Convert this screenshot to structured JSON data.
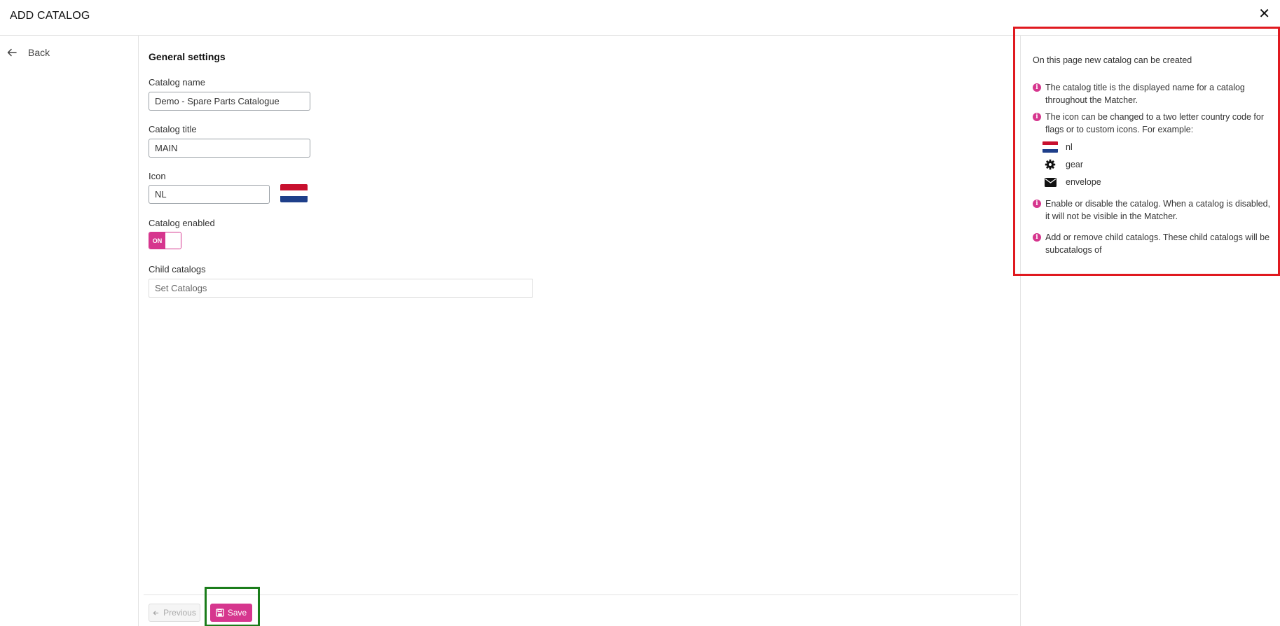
{
  "header": {
    "title": "ADD CATALOG",
    "close_label": "✕"
  },
  "nav": {
    "back_label": "Back"
  },
  "form": {
    "section_title": "General settings",
    "catalog_name": {
      "label": "Catalog name",
      "value": "Demo - Spare Parts Catalogue"
    },
    "catalog_title": {
      "label": "Catalog title",
      "value": "MAIN"
    },
    "icon": {
      "label": "Icon",
      "value": "NL",
      "preview": "flag-nl-icon"
    },
    "catalog_enabled": {
      "label": "Catalog enabled",
      "toggle_text": "ON",
      "state": true
    },
    "child_catalogs": {
      "label": "Child catalogs",
      "placeholder": "Set Catalogs"
    }
  },
  "footer": {
    "previous_label": "Previous",
    "save_label": "Save"
  },
  "help": {
    "intro": "On this page new catalog can be created",
    "items": [
      "The catalog title is the displayed name for a catalog throughout the Matcher.",
      "The icon can be changed to a two letter country code for flags or to custom icons. For example:",
      "Enable or disable the catalog. When a catalog is disabled, it will not be visible in the Matcher.",
      "Add or remove child catalogs. These child catalogs will be subcatalogs of"
    ],
    "examples": [
      {
        "icon": "flag-nl-icon",
        "label": "nl"
      },
      {
        "icon": "gear-icon",
        "label": "gear"
      },
      {
        "icon": "envelope-icon",
        "label": "envelope"
      }
    ]
  },
  "colors": {
    "accent": "#d6368e",
    "highlight_red": "#e0191f",
    "highlight_green": "#1b7d1b",
    "flag_red": "#c8102e",
    "flag_blue": "#1e3f8a"
  }
}
